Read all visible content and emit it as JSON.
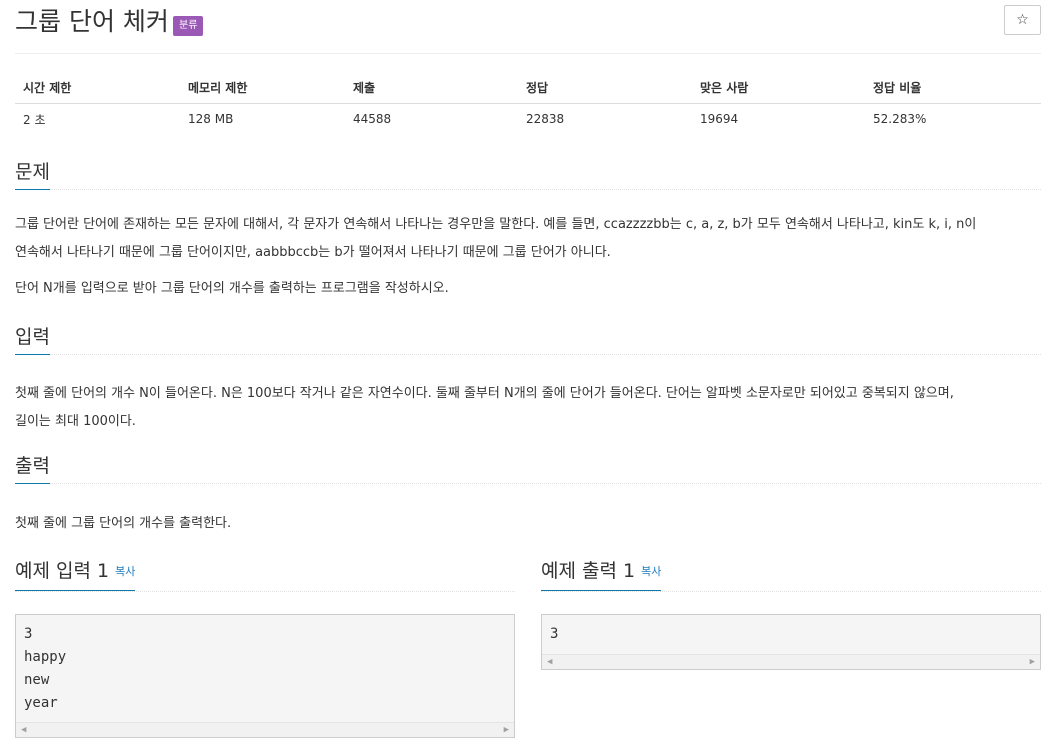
{
  "header": {
    "title": "그룹 단어 체커",
    "badge": "분류",
    "star": "☆"
  },
  "stats": {
    "headers": [
      "시간 제한",
      "메모리 제한",
      "제출",
      "정답",
      "맞은 사람",
      "정답 비율"
    ],
    "values": [
      "2 초",
      "128 MB",
      "44588",
      "22838",
      "19694",
      "52.283%"
    ]
  },
  "problem": {
    "heading": "문제",
    "para1_line1": "그룹 단어란 단어에 존재하는 모든 문자에 대해서, 각 문자가 연속해서 나타나는 경우만을 말한다. 예를 들면, ccazzzzbb는 c, a, z, b가 모두 연속해서 나타나고, kin도 k, i, n이",
    "para1_line2": "연속해서 나타나기 때문에 그룹 단어이지만, aabbbccb는 b가 떨어져서 나타나기 때문에 그룹 단어가 아니다.",
    "para2": "단어 N개를 입력으로 받아 그룹 단어의 개수를 출력하는 프로그램을 작성하시오."
  },
  "input": {
    "heading": "입력",
    "line1": "첫째 줄에 단어의 개수 N이 들어온다. N은 100보다 작거나 같은 자연수이다. 둘째 줄부터 N개의 줄에 단어가 들어온다. 단어는 알파벳 소문자로만 되어있고 중복되지 않으며,",
    "line2": "길이는 최대 100이다."
  },
  "output": {
    "heading": "출력",
    "text": "첫째 줄에 그룹 단어의 개수를 출력한다."
  },
  "sample_input": {
    "heading": "예제 입력 1",
    "copy": "복사",
    "lines": [
      "3",
      "happy",
      "new",
      "year"
    ]
  },
  "sample_output": {
    "heading": "예제 출력 1",
    "copy": "복사",
    "lines": [
      "3"
    ]
  },
  "scroll_arrows": {
    "left": "◀",
    "right": "▶"
  }
}
